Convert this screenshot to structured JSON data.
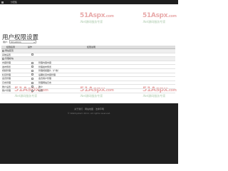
{
  "topbar": {
    "tab_label": "分宏集"
  },
  "watermark": {
    "brand": "51Aspx",
    "domain": ".com",
    "slogan": ".Net源码服务专家"
  },
  "page": {
    "title": "用户权限设置"
  },
  "user_select": {
    "label": "用户:",
    "value": "XX.Admin"
  },
  "table": {
    "headers": [
      "权限名称",
      "操作",
      "权限说明"
    ],
    "rows": [
      {
        "type": "group",
        "name": "网站配置",
        "checked": false
      },
      {
        "type": "item",
        "name": "系统设置",
        "desc": ""
      },
      {
        "type": "group",
        "name": "管理模块",
        "checked": false
      },
      {
        "type": "item",
        "name": "内容管理",
        "desc": "管理内容内容"
      },
      {
        "type": "item",
        "name": "发布预览",
        "desc": "管理发布预览"
      },
      {
        "type": "item",
        "name": "视频管理",
        "desc": "管理视频图片（广告）"
      },
      {
        "type": "item",
        "name": "栏目管理",
        "desc": "后期栏目内容管理"
      },
      {
        "type": "item",
        "name": "会员管理",
        "desc": "会员用户管理"
      },
      {
        "type": "item",
        "name": "日志管理",
        "desc": "管理网站日志"
      },
      {
        "type": "item",
        "name": "账户设置",
        "desc": "账户"
      },
      {
        "type": "item",
        "name": "账户管理",
        "desc": "权限"
      }
    ]
  },
  "footer": {
    "links": "关于我们 · 网站地图 · 法律声明",
    "copyright": "© WebSystem 2011. All rights reserved."
  }
}
